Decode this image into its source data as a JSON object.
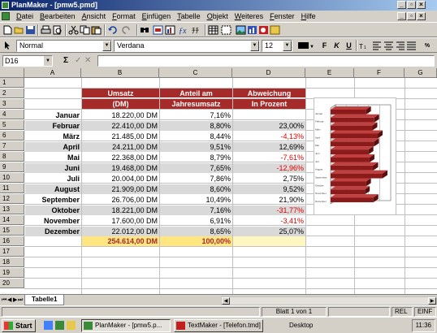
{
  "window": {
    "title": "PlanMaker - [pmw5.pmd]"
  },
  "menu": {
    "items": [
      "Datei",
      "Bearbeiten",
      "Ansicht",
      "Format",
      "Einfügen",
      "Tabelle",
      "Objekt",
      "Weiteres",
      "Fenster",
      "Hilfe"
    ]
  },
  "format_toolbar": {
    "style": "Normal",
    "font": "Verdana",
    "size": "12",
    "bold": "F",
    "italic": "K",
    "underline": "U",
    "zoom": "% "
  },
  "formula_bar": {
    "cell_ref": "D16",
    "sum_symbol": "Σ",
    "accept_symbol": "✓",
    "cancel_symbol": "✕",
    "content": ""
  },
  "sheet": {
    "columns": [
      "A",
      "B",
      "C",
      "D",
      "E",
      "F",
      "G"
    ],
    "rows": [
      "1",
      "2",
      "3",
      "4",
      "5",
      "6",
      "7",
      "8",
      "9",
      "10",
      "11",
      "12",
      "13",
      "14",
      "15",
      "16",
      "17",
      "18",
      "19",
      "20"
    ],
    "header_row1": [
      "Umsatz",
      "Anteil am",
      "Abweichung"
    ],
    "header_row2": [
      "(DM)",
      "Jahresumsatz",
      "In Prozent"
    ],
    "data": [
      {
        "month": "Januar",
        "umsatz": "18.220,00 DM",
        "anteil": "7,16%",
        "abweichung": "",
        "negative": false
      },
      {
        "month": "Februar",
        "umsatz": "22.410,00 DM",
        "anteil": "8,80%",
        "abweichung": "23,00%",
        "negative": false
      },
      {
        "month": "März",
        "umsatz": "21.485,00 DM",
        "anteil": "8,44%",
        "abweichung": "-4,13%",
        "negative": true
      },
      {
        "month": "April",
        "umsatz": "24.211,00 DM",
        "anteil": "9,51%",
        "abweichung": "12,69%",
        "negative": false
      },
      {
        "month": "Mai",
        "umsatz": "22.368,00 DM",
        "anteil": "8,79%",
        "abweichung": "-7,61%",
        "negative": true
      },
      {
        "month": "Juni",
        "umsatz": "19.468,00 DM",
        "anteil": "7,65%",
        "abweichung": "-12,96%",
        "negative": true
      },
      {
        "month": "Juli",
        "umsatz": "20.004,00 DM",
        "anteil": "7,86%",
        "abweichung": "2,75%",
        "negative": false
      },
      {
        "month": "August",
        "umsatz": "21.909,00 DM",
        "anteil": "8,60%",
        "abweichung": "9,52%",
        "negative": false
      },
      {
        "month": "September",
        "umsatz": "26.706,00 DM",
        "anteil": "10,49%",
        "abweichung": "21,90%",
        "negative": false
      },
      {
        "month": "Oktober",
        "umsatz": "18.221,00 DM",
        "anteil": "7,16%",
        "abweichung": "-31,77%",
        "negative": true
      },
      {
        "month": "November",
        "umsatz": "17.600,00 DM",
        "anteil": "6,91%",
        "abweichung": "-3,41%",
        "negative": true
      },
      {
        "month": "Dezember",
        "umsatz": "22.012,00 DM",
        "anteil": "8,65%",
        "abweichung": "25,07%",
        "negative": false
      }
    ],
    "total": {
      "umsatz": "254.614,00 DM",
      "anteil": "100,00%"
    }
  },
  "chart_data": {
    "type": "bar",
    "orientation": "horizontal",
    "style": "3d",
    "categories": [
      "Januar",
      "Februar",
      "März",
      "April",
      "Mai",
      "Juni",
      "Juli",
      "August",
      "September",
      "Oktober",
      "November",
      "Dezember"
    ],
    "values": [
      18220,
      22410,
      21485,
      24211,
      22368,
      19468,
      20004,
      21909,
      26706,
      18221,
      17600,
      22012
    ],
    "title": "",
    "xlabel": "",
    "ylabel": "",
    "bar_color": "#8b1a1a",
    "grid": true
  },
  "tabs": {
    "nav": [
      "⏮",
      "◀",
      "▶",
      "⏭"
    ],
    "active": "Tabelle1"
  },
  "status": {
    "page": "Blatt 1 von 1",
    "mode1": "REL",
    "mode2": "EINF"
  },
  "taskbar": {
    "start": "Start",
    "tasks": [
      "PlanMaker - [pmw5.p...",
      "TextMaker - [Telefon.tmd]"
    ],
    "desktop": "Desktop",
    "time": "11:36"
  },
  "colors": {
    "header_bg": "#a52a2a",
    "alt_row": "#d9d9d9",
    "total_bg": "#ffe680",
    "negative": "#e00000"
  }
}
